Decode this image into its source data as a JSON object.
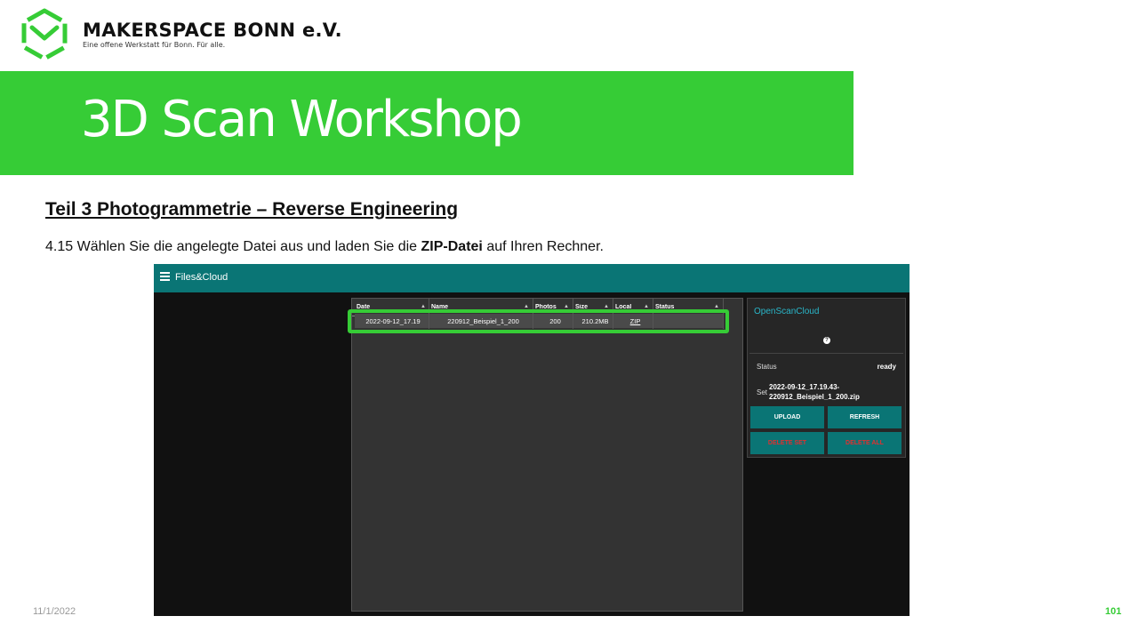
{
  "header": {
    "org_name": "MAKERSPACE BONN e.V.",
    "org_tagline": "Eine offene Werkstatt für Bonn. Für alle.",
    "logo_icon": "makerspace-cube-logo",
    "brand_color": "#36cc36"
  },
  "banner": {
    "title": "3D Scan Workshop"
  },
  "slide": {
    "subtitle": "Teil 3  Photogrammetrie  – Reverse Engineering",
    "instruction_prefix": "4.15 Wählen Sie die angelegte Datei aus und laden Sie die ",
    "instruction_bold": "ZIP-Datei",
    "instruction_suffix": " auf Ihren Rechner."
  },
  "app": {
    "title": "Files&Cloud",
    "menu_icon": "hamburger-menu-icon",
    "accent_color": "#0a7575",
    "table": {
      "columns": [
        "Date",
        "Name",
        "Photos",
        "Size",
        "Local",
        "Status"
      ],
      "rows": [
        {
          "date": "2022-09-12_17.19",
          "name": "220912_Beispiel_1_200",
          "photos": "200",
          "size": "210.2MB",
          "local": "ZIP",
          "status": ""
        }
      ]
    },
    "cloud_panel": {
      "title": "OpenScanCloud",
      "help_icon": "question-circle-icon",
      "status_label": "Status",
      "status_value": "ready",
      "set_label": "Set",
      "set_value_line1": "2022-09-12_17.19.43-",
      "set_value_line2": "220912_Beispiel_1_200.zip",
      "upload_label": "UPLOAD",
      "refresh_label": "REFRESH",
      "delete_set_label": "DELETE SET",
      "delete_all_label": "DELETE ALL"
    }
  },
  "footer": {
    "date": "11/1/2022",
    "page_number": "101"
  }
}
